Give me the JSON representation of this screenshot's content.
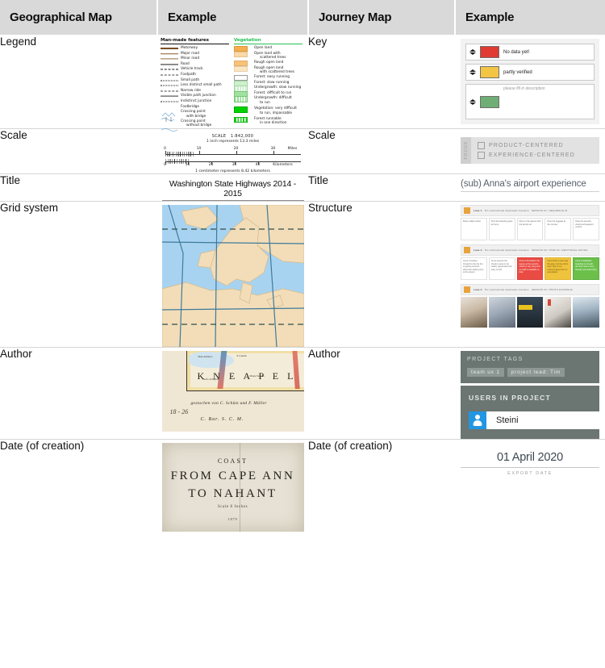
{
  "header": {
    "columns": [
      "Geographical Map",
      "Example",
      "Journey Map",
      "Example"
    ]
  },
  "rows": [
    {
      "geo_label": "Legend",
      "journey_label": "Key",
      "geo_example": {
        "kind": "orienteering-legend",
        "man_made": {
          "heading": "Man-made features",
          "items": [
            "Motorway",
            "Major road",
            "Minor road",
            "Road",
            "Vehicle track",
            "Footpath",
            "Small path",
            "Less distinct small path",
            "Narrow ride",
            "Visible path junction",
            "Indistinct junction",
            "Footbridge",
            "Crossing point",
            "with bridge",
            "Crossing point",
            "without bridge"
          ]
        },
        "vegetation": {
          "heading": "Vegetation",
          "items": [
            "Open land",
            "Open land with",
            "scattered trees",
            "Rough open land",
            "Rough open land",
            "with scattered trees",
            "Forest: easy running",
            "Forest: slow running",
            "Undergrowth: slow running",
            "Forest: difficult to run",
            "Undergrowth: difficult",
            "to run",
            "Vegetation: very difficult",
            "to run, impassable",
            "Forest runnable",
            "in one direction"
          ]
        }
      },
      "journey_example": {
        "kind": "journey-key",
        "rows": [
          {
            "color": "#e03a32",
            "text": "No data yet!",
            "placeholder": false
          },
          {
            "color": "#f3c544",
            "text": "partly verified",
            "placeholder": false
          },
          {
            "color": "#6fae74",
            "text": "please fill in description",
            "placeholder": true
          }
        ]
      }
    },
    {
      "geo_label": "Scale",
      "journey_label": "Scale",
      "geo_example": {
        "kind": "scale-bar",
        "scale_label": "SCALE",
        "scale_ratio": "1:842,000",
        "inch_note": "1 inch represents 13.3 miles",
        "cm_note": "1 centimeter represents 8.42 kilometers",
        "miles_ticks": [
          "0",
          "10",
          "20",
          "30"
        ],
        "miles_unit": "Miles",
        "km_ticks": [
          "0",
          "10",
          "20",
          "30",
          "40"
        ],
        "km_unit": "Kilometers"
      },
      "journey_example": {
        "kind": "focus-selector",
        "vertical_label": "FOCUS",
        "options": [
          {
            "label": "PRODUCT-CENTERED",
            "checked": false
          },
          {
            "label": "EXPERIENCE-CENTERED",
            "checked": false
          }
        ]
      }
    },
    {
      "geo_label": "Title",
      "journey_label": "Title",
      "geo_example": {
        "kind": "map-title",
        "text": "Washington State Highways 2014 - 2015"
      },
      "journey_example": {
        "kind": "journey-title",
        "text": "(sub) Anna's airport experience"
      }
    },
    {
      "geo_label": "Grid system",
      "journey_label": "Structure",
      "geo_example": {
        "kind": "graticule-map"
      },
      "journey_example": {
        "kind": "journey-board",
        "lanes": [
          {
            "header_title": "Lane 1",
            "header_note": "The international destination travelers",
            "header_meta": "SESSION 01 / SEQUENCE 01",
            "cards": [
              {
                "text": "Book a flight online",
                "color": "white"
              },
              {
                "text": "Print the boarding pass at home",
                "color": "white"
              },
              {
                "text": "Drive to the airport with the family car",
                "color": "white"
              },
              {
                "text": "Drop the luggage at the counter",
                "color": "white"
              },
              {
                "text": "Pass the security check and passport control",
                "color": "white"
              }
            ]
          },
          {
            "header_title": "Lane 2",
            "header_note": "The international destination travelers",
            "header_meta": "SESSION 02 / STEP 02 / EMOTIONAL RATING",
            "cards": [
              {
                "text": "Anna is looking forward to the trip but is getting nervous about the waiting time at the airport",
                "color": "white"
              },
              {
                "text": "Anna expects the check-in area to be clearly signposted and easy to find",
                "color": "white"
              },
              {
                "text": "Anna is frustrated: the queue at the security check is very long and no staff is available to help",
                "color": "red"
              },
              {
                "text": "Anna finds a seat near the gate, but the wifi is slow. She is not entirely happy but it is acceptable",
                "color": "yel"
              },
              {
                "text": "Anna is delighted: boarding is smooth and the crew is very friendly and welcoming",
                "color": "grn"
              }
            ]
          },
          {
            "header_title": "Lane 3",
            "header_note": "The international destination travelers",
            "header_meta": "SESSION 03 / PHOTO EVIDENCE",
            "photos": [
              "check-in-desk-photo",
              "terminal-crowd-photo",
              "security-lane-photo",
              "lounge-workspace-photo",
              "boarding-gate-photo"
            ]
          }
        ]
      }
    },
    {
      "geo_label": "Author",
      "journey_label": "Author",
      "geo_example": {
        "kind": "antique-map",
        "region_label": "K N E A P E L",
        "engraver_line": "gestochen von C. Schütz und F. Müller",
        "sketch_number": "18 - 26",
        "imprint": "C. Bar. S. C. M."
      },
      "journey_example": {
        "kind": "project-people",
        "tags_heading": "PROJECT TAGS",
        "tags": [
          "team ux 1",
          "project lead: Tim"
        ],
        "users_heading": "USERS IN PROJECT",
        "users": [
          "Steini"
        ]
      }
    },
    {
      "geo_label": "Date (of creation)",
      "journey_label": "Date (of creation)",
      "geo_example": {
        "kind": "coast-chart",
        "line1": "COAST",
        "line2": "FROM CAPE ANN",
        "line3": "TO NAHANT",
        "line4": "Scale 8 Inches",
        "line5": "1879"
      },
      "journey_example": {
        "kind": "export-date",
        "date": "01 April 2020",
        "label": "EXPORT DATE"
      }
    }
  ],
  "colors": {
    "header_bg": "#d9d9d9",
    "key_red": "#e03a32",
    "key_yellow": "#f3c544",
    "key_green": "#6fae74",
    "panel_gray": "#6b7571",
    "avatar_blue": "#2196e3"
  }
}
